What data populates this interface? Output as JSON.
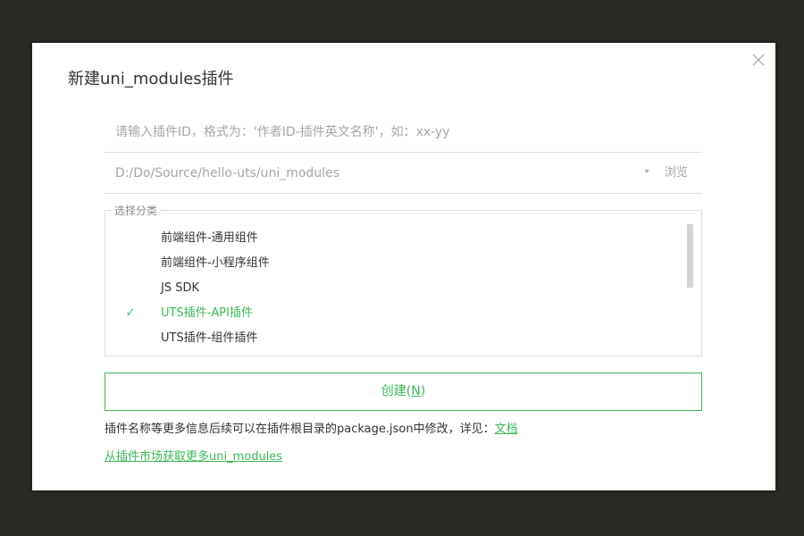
{
  "dialog": {
    "title": "新建uni_modules插件"
  },
  "plugin_id": {
    "placeholder": "请输入插件ID，格式为：'作者ID-插件英文名称'，如：xx-yy",
    "value": ""
  },
  "location": {
    "path": "D:/Do/Source/hello-uts/uni_modules",
    "browse_label": "浏览"
  },
  "category": {
    "legend": "选择分类",
    "items": [
      {
        "label": "前端组件-通用组件",
        "selected": false
      },
      {
        "label": "前端组件-小程序组件",
        "selected": false
      },
      {
        "label": "JS SDK",
        "selected": false
      },
      {
        "label": "UTS插件-API插件",
        "selected": true
      },
      {
        "label": "UTS插件-组件插件",
        "selected": false
      }
    ],
    "check_glyph": "✓"
  },
  "create_button": {
    "label": "创建(",
    "shortcut": "N",
    "suffix": ")"
  },
  "note": {
    "text": "插件名称等更多信息后续可以在插件根目录的package.json中修改，详见：",
    "link": "文档"
  },
  "market_link": "从插件市场获取更多uni_modules",
  "colors": {
    "accent": "#3fb559",
    "overlay": "#2a2a24"
  }
}
